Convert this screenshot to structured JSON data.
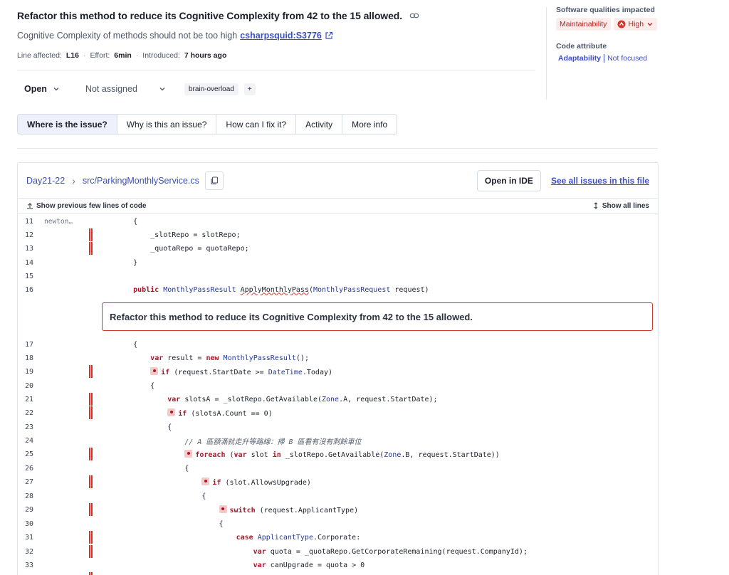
{
  "header": {
    "title": "Refactor this method to reduce its Cognitive Complexity from 42 to the 15 allowed.",
    "rule_description": "Cognitive Complexity of methods should not be too high",
    "rule_key": "csharpsquid:S3776",
    "line_label": "Line affected:",
    "line_value": "L16",
    "effort_label": "Effort:",
    "effort_value": "6min",
    "introduced_label": "Introduced:",
    "introduced_value": "7 hours ago"
  },
  "status": {
    "status_value": "Open",
    "assignee_value": "Not assigned",
    "tag": "brain-overload",
    "tag_add": "+"
  },
  "tabs": [
    {
      "label": "Where is the issue?",
      "active": true
    },
    {
      "label": "Why is this an issue?",
      "active": false
    },
    {
      "label": "How can I fix it?",
      "active": false
    },
    {
      "label": "Activity",
      "active": false
    },
    {
      "label": "More info",
      "active": false
    }
  ],
  "sidebar": {
    "qualities_heading": "Software qualities impacted",
    "quality": "Maintainability",
    "severity": "High",
    "attribute_heading": "Code attribute",
    "attribute": "Adaptability",
    "attribute_sub": "Not focused"
  },
  "code_panel": {
    "project": "Day21-22",
    "file_path": "src/ParkingMonthlyService.cs",
    "open_ide": "Open in IDE",
    "see_all": "See all issues in this file",
    "show_previous": "Show previous few lines of code",
    "show_all": "Show all lines",
    "issue_message": "Refactor this method to reduce its Cognitive Complexity from 42 to the 15 allowed.",
    "author": "newton…"
  },
  "code_lines": [
    {
      "n": "11",
      "text": "    {"
    },
    {
      "n": "12",
      "text": "        _slotRepo = slotRepo;"
    },
    {
      "n": "13",
      "text": "        _quotaRepo = quotaRepo;"
    },
    {
      "n": "14",
      "text": "    }"
    },
    {
      "n": "15",
      "text": ""
    },
    {
      "n": "16",
      "text": "    public MonthlyPassResult ApplyMonthlyPass(MonthlyPassRequest request)"
    },
    {
      "n": "17",
      "text": "    {"
    },
    {
      "n": "18",
      "text": "        var result = new MonthlyPassResult();"
    },
    {
      "n": "19",
      "text": "        if (request.StartDate >= DateTime.Today)"
    },
    {
      "n": "20",
      "text": "        {"
    },
    {
      "n": "21",
      "text": "            var slotsA = _slotRepo.GetAvailable(Zone.A, request.StartDate);"
    },
    {
      "n": "22",
      "text": "            if (slotsA.Count == 0)"
    },
    {
      "n": "23",
      "text": "            {"
    },
    {
      "n": "24",
      "text": "                // A 區額滿就走升等路線：掃 B 區看有沒有剩餘車位"
    },
    {
      "n": "25",
      "text": "                foreach (var slot in _slotRepo.GetAvailable(Zone.B, request.StartDate))"
    },
    {
      "n": "26",
      "text": "                {"
    },
    {
      "n": "27",
      "text": "                    if (slot.AllowsUpgrade)"
    },
    {
      "n": "28",
      "text": "                    {"
    },
    {
      "n": "29",
      "text": "                        switch (request.ApplicantType)"
    },
    {
      "n": "30",
      "text": "                        {"
    },
    {
      "n": "31",
      "text": "                            case ApplicantType.Corporate:"
    },
    {
      "n": "32",
      "text": "                                var quota = _quotaRepo.GetCorporateRemaining(request.CompanyId);"
    },
    {
      "n": "33",
      "text": "                                var canUpgrade = quota > 0"
    }
  ],
  "colors": {
    "accent": "#3b4ec2",
    "danger": "#d0372b",
    "keyword": "#b5122a",
    "type": "#24389c"
  }
}
